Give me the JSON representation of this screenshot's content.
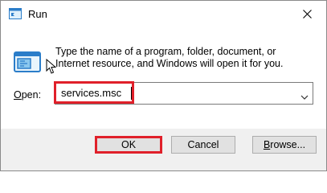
{
  "window": {
    "title": "Run",
    "icon": "run-icon",
    "close_icon": "close-icon"
  },
  "dialog": {
    "description": "Type the name of a program, folder, document, or Internet resource, and Windows will open it for you.",
    "open_label_first": "O",
    "open_label_rest": "pen:",
    "open_value": "services.msc",
    "dropdown_icon": "chevron-down-icon"
  },
  "buttons": {
    "ok": "OK",
    "cancel": "Cancel",
    "browse_first": "B",
    "browse_rest": "rowse..."
  },
  "colors": {
    "highlight": "#e0202a",
    "window_bg": "#f0f0f0",
    "button_bg": "#e1e1e1"
  }
}
